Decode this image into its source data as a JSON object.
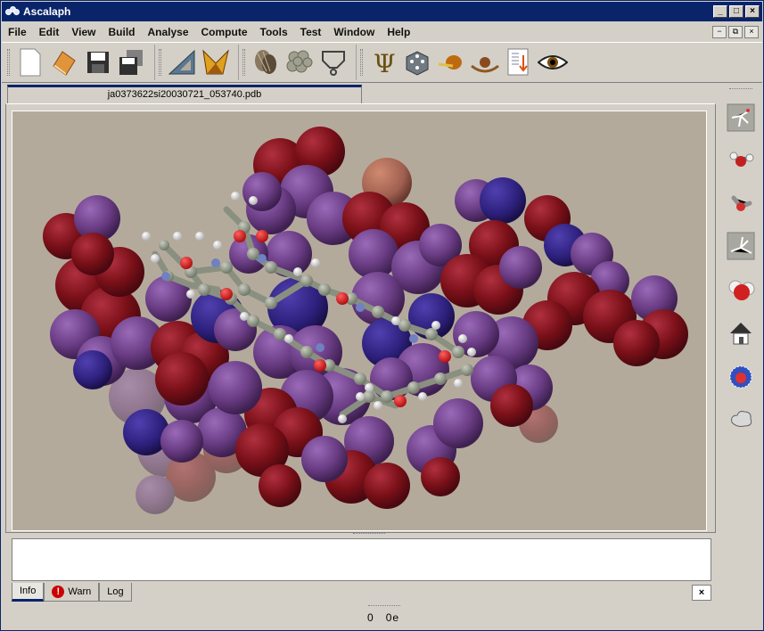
{
  "window": {
    "title": "Ascalaph",
    "minimize": "_",
    "maximize": "□",
    "close": "×"
  },
  "menu": [
    "File",
    "Edit",
    "View",
    "Build",
    "Analyse",
    "Compute",
    "Tools",
    "Test",
    "Window",
    "Help"
  ],
  "mdi_controls": [
    "−",
    "⧉",
    "×"
  ],
  "toolbar": {
    "icons": [
      "new-file-icon",
      "open-book-icon",
      "save-icon",
      "save-all-icon",
      "set-square-icon",
      "bookmark-fold-icon",
      "seashells-icon",
      "cluster-icon",
      "beaker-stand-icon",
      "psi-icon",
      "dice-icon",
      "snail-icon",
      "ball-in-well-icon",
      "document-arrow-icon",
      "eye-icon"
    ]
  },
  "document": {
    "tab_title": "ja0373622si20030721_053740.pdb"
  },
  "sidebar": {
    "tools": [
      "wireframe-model-icon",
      "ball-stick-water-icon",
      "stick-water-icon",
      "axis-model-icon",
      "spacefill-water-icon",
      "house-icon",
      "spacefill-mesh-icon",
      "cloud-surface-icon"
    ]
  },
  "log": {
    "tabs": [
      "Info",
      "Warn",
      "Log"
    ],
    "active_tab": "Info",
    "close": "×"
  },
  "status": {
    "count": "0",
    "unit": "0e"
  },
  "colors": {
    "titlebar": "#0a246a",
    "viewport_bg": "#b4aa9c",
    "atom_oxygen": "#7a1018",
    "atom_carbon": "#6b3d85",
    "atom_nitrogen": "#2c1f7a"
  }
}
